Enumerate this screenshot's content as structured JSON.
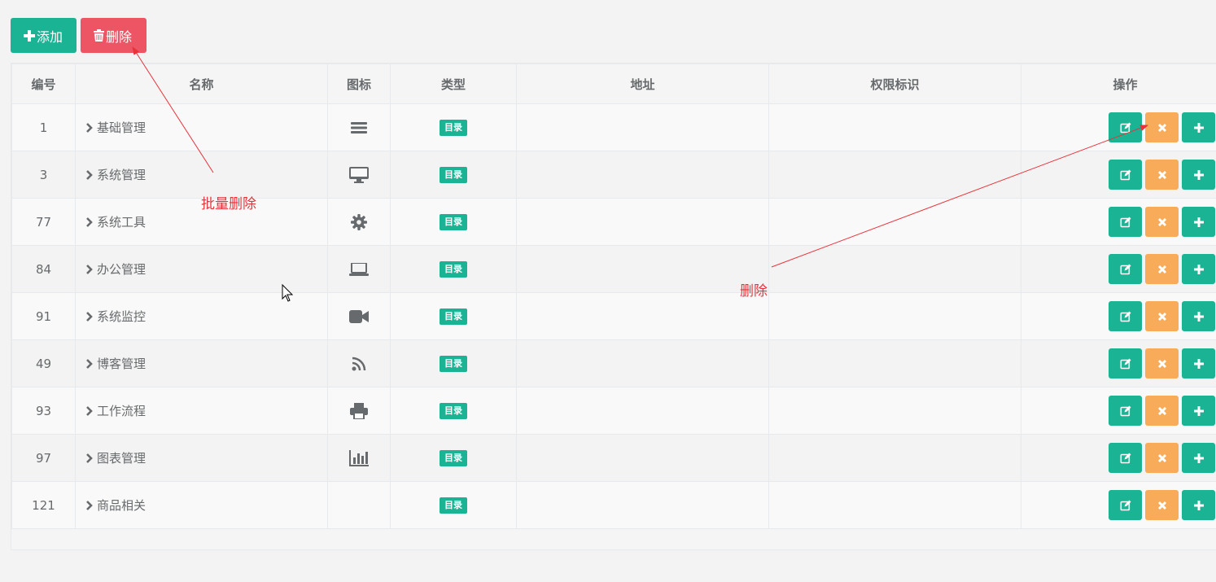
{
  "toolbar": {
    "add_label": "添加",
    "delete_label": "删除"
  },
  "table": {
    "headers": {
      "id": "编号",
      "name": "名称",
      "icon": "图标",
      "type": "类型",
      "url": "地址",
      "perms": "权限标识",
      "ops": "操作"
    },
    "rows": [
      {
        "id": "1",
        "name": "基础管理",
        "icon": "bars-icon",
        "type": "目录",
        "url": "",
        "perms": ""
      },
      {
        "id": "3",
        "name": "系统管理",
        "icon": "desktop-icon",
        "type": "目录",
        "url": "",
        "perms": ""
      },
      {
        "id": "77",
        "name": "系统工具",
        "icon": "gear-icon",
        "type": "目录",
        "url": "",
        "perms": ""
      },
      {
        "id": "84",
        "name": "办公管理",
        "icon": "laptop-icon",
        "type": "目录",
        "url": "",
        "perms": ""
      },
      {
        "id": "91",
        "name": "系统监控",
        "icon": "video-camera-icon",
        "type": "目录",
        "url": "",
        "perms": ""
      },
      {
        "id": "49",
        "name": "博客管理",
        "icon": "rss-icon",
        "type": "目录",
        "url": "",
        "perms": ""
      },
      {
        "id": "93",
        "name": "工作流程",
        "icon": "print-icon",
        "type": "目录",
        "url": "",
        "perms": ""
      },
      {
        "id": "97",
        "name": "图表管理",
        "icon": "bar-chart-icon",
        "type": "目录",
        "url": "",
        "perms": ""
      },
      {
        "id": "121",
        "name": "商品相关",
        "icon": "",
        "type": "目录",
        "url": "",
        "perms": ""
      }
    ]
  },
  "annotations": {
    "batch_delete": "批量删除",
    "delete": "删除"
  },
  "colors": {
    "primary": "#1ab394",
    "danger": "#ed5565",
    "warning": "#f8ac59",
    "annotation": "#e8333b"
  }
}
